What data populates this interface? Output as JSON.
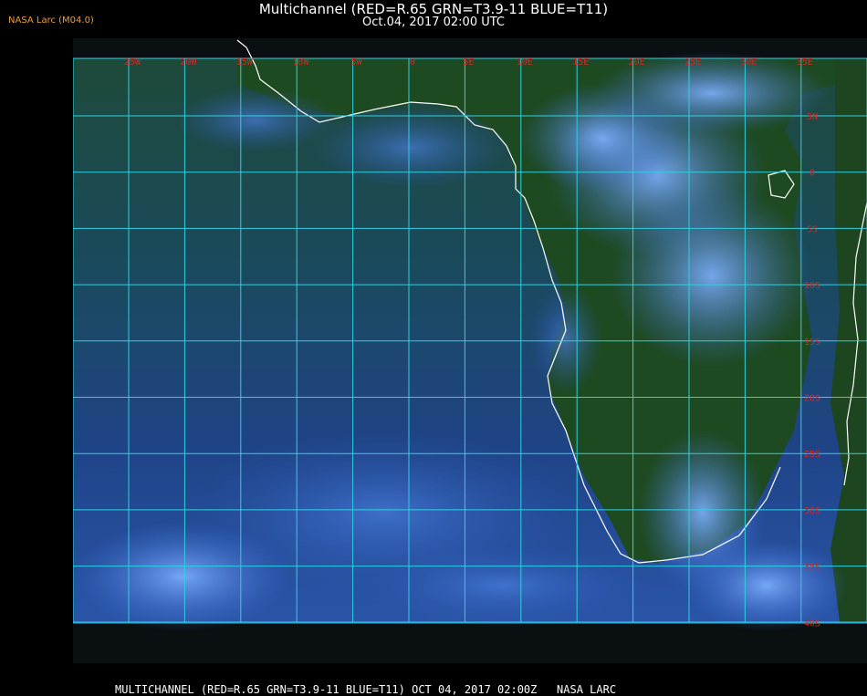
{
  "header": {
    "title": "Multichannel (RED=R.65 GRN=T3.9-11 BLUE=T11)",
    "date": "Oct.04, 2017 02:00 UTC"
  },
  "corner_label": "NASA Larc (M04.0)",
  "footer": "MULTICHANNEL (RED=R.65 GRN=T3.9-11 BLUE=T11) OCT 04, 2017 02:00Z   NASA LARC",
  "grid": {
    "longitudes": [
      "25W",
      "20W",
      "15W",
      "10W",
      "5W",
      "0",
      "5E",
      "10E",
      "15E",
      "20E",
      "25E",
      "30E",
      "35E"
    ],
    "latitudes": [
      "5N",
      "0",
      "5S",
      "10S",
      "15S",
      "20S",
      "25S",
      "30S",
      "35S",
      "40S"
    ]
  },
  "colors": {
    "grid_line": "#30d0e0",
    "grid_label": "#d02a2a",
    "coastline": "#ffffff",
    "corner_label": "#e8a040",
    "land": "#1f4a22",
    "ocean": "#1c3e7a",
    "cloud": "#5a8ff0"
  }
}
